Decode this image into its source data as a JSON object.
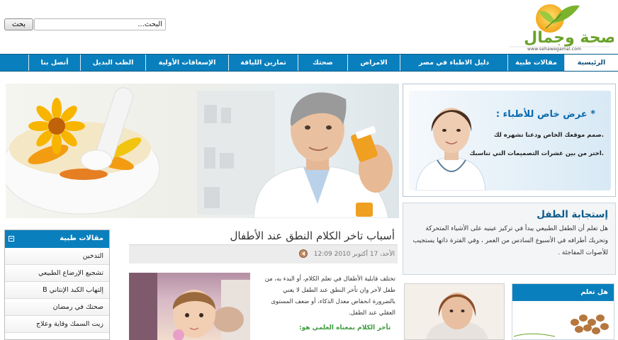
{
  "search": {
    "button_label": "بحث",
    "value": "البحث..."
  },
  "logo": {
    "text": "صحة وجمال",
    "url_text": "www.sehawegamal.com"
  },
  "nav": {
    "items": [
      "الرئيسية",
      "مقالات طبية",
      "دليل الاطباء في مصر",
      "الامراض",
      "صحتك",
      "تمارين اللياقة",
      "الإسعافات الأولية",
      "الطب البديل",
      "أتصل بنا"
    ]
  },
  "promo": {
    "title": "* عرض خاص للأطباء :",
    "line1": ".صمم موقعك الخاص ودعنا نشهره لك",
    "line2": ".اختر من بين عشرات التصميمات التي تناسبك"
  },
  "info": {
    "title": "إستجابة الطفل",
    "text": "هل تعلم أن الطفل الطبيعي يبدأ في تركيز عينيه على الأشياء المتحركة وتحريك أطرافه في الأسبوع السادس من العمر ، وفي الفترة ذاتها يستجيب للأصوات المفاجئة ."
  },
  "sidebar": {
    "title": "مقالات طبية",
    "items": [
      "التدخين",
      "تشجيع الإرضاع الطبيعي",
      "إلتهاب الكبد الإنتاني B",
      "صحتك في رمضان",
      "زيت السمك وقاية وعلاج"
    ]
  },
  "article": {
    "title": "أسباب تاخر الكلام النطق عند الأطفال",
    "meta": "الأحد، 17 أكتوبر 2010 12:09",
    "body": "تختلف قابلية الأطفال في تعلم الكلام، أو البدء به، من طفل لآخر وان تأخر النطق عند الطفل لا يعني بالضرورة انخفاض معدل الذكاء، أو ضعف المستوى العقلي عند الطفل.",
    "subheading": "تأخر الكلام بمعناه العلمي هو:"
  },
  "did_you_know": {
    "title": "هل تعلم"
  },
  "colors": {
    "nav_blue": "#0a7fbd",
    "title_blue": "#0b5c8c",
    "green": "#3c9b3c"
  }
}
